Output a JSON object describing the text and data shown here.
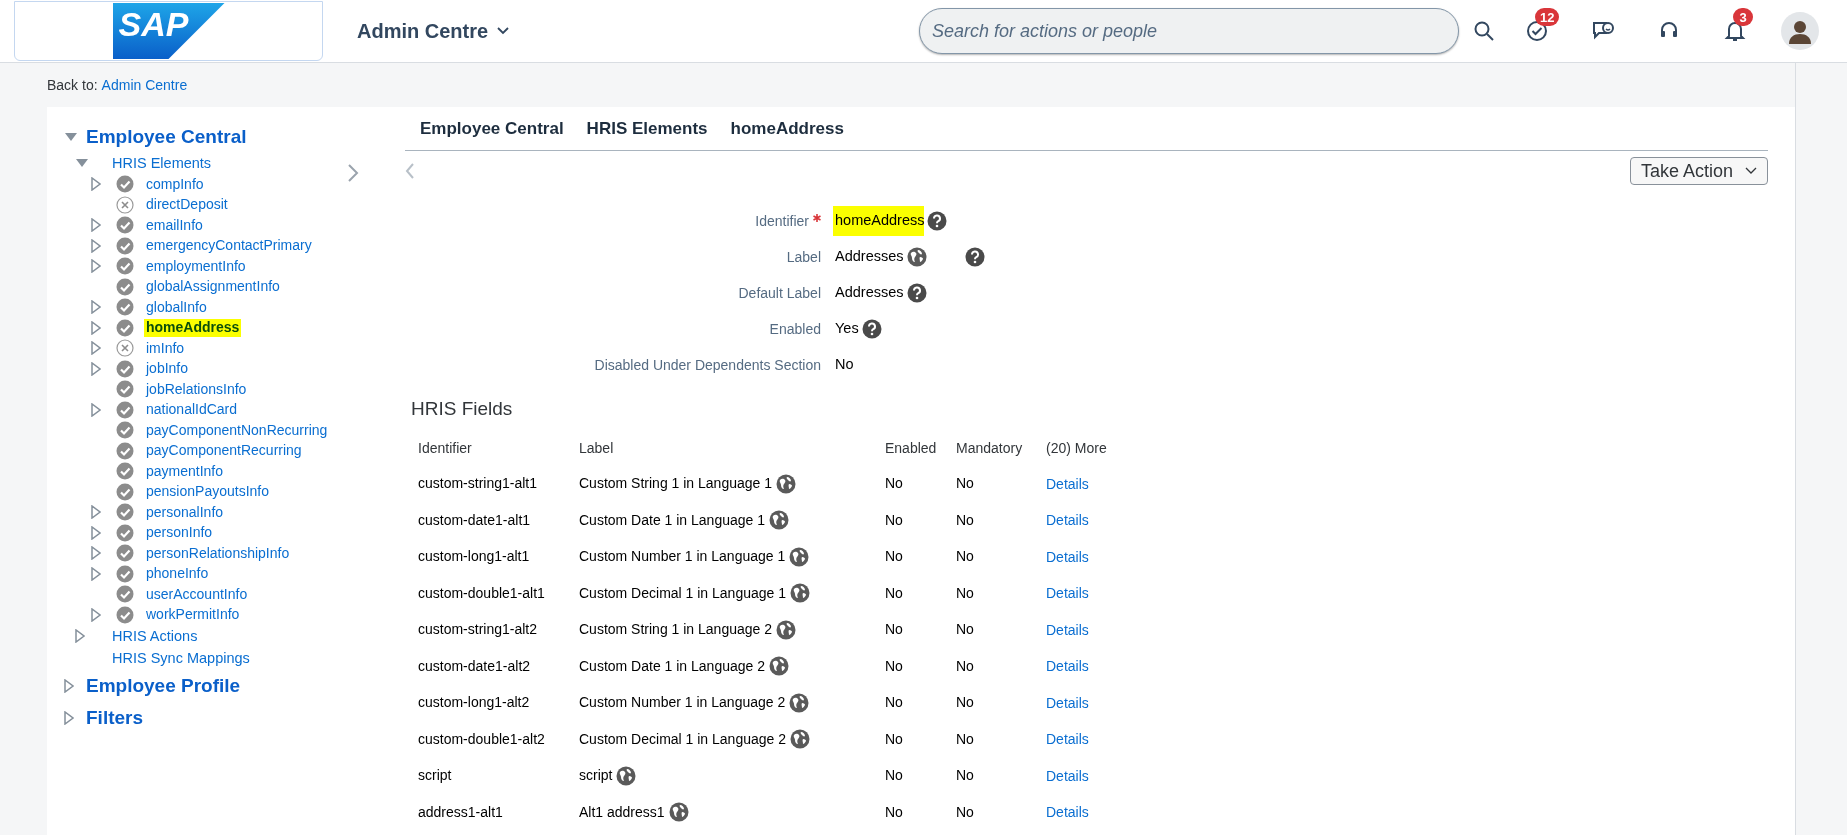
{
  "header": {
    "logo_text": "SAP",
    "app_title": "Admin Centre",
    "search": {
      "placeholder": "Search for actions or people"
    },
    "badges": [
      {
        "kind": "tasks",
        "count": "12"
      },
      {
        "kind": "feedback"
      },
      {
        "kind": "support"
      },
      {
        "kind": "notifications",
        "count": "3"
      }
    ]
  },
  "back_link": {
    "label": "Back to:",
    "link": "Admin Centre"
  },
  "tree": [
    {
      "label": "Employee Central",
      "expandable": true,
      "expanded": true,
      "selected": false,
      "children": [
        {
          "label": "HRIS Elements",
          "expandable": true,
          "expanded": true,
          "selected": false,
          "children": [
            {
              "label": "compInfo",
              "expandable": true,
              "expanded": false,
              "enabled": true,
              "selected": false
            },
            {
              "label": "directDeposit",
              "expandable": false,
              "enabled": false,
              "selected": false
            },
            {
              "label": "emailInfo",
              "expandable": true,
              "expanded": false,
              "enabled": true,
              "selected": false
            },
            {
              "label": "emergencyContactPrimary",
              "expandable": true,
              "expanded": false,
              "enabled": true,
              "selected": false
            },
            {
              "label": "employmentInfo",
              "expandable": true,
              "expanded": false,
              "enabled": true,
              "selected": false
            },
            {
              "label": "globalAssignmentInfo",
              "expandable": false,
              "enabled": true,
              "selected": false
            },
            {
              "label": "globalInfo",
              "expandable": true,
              "expanded": false,
              "enabled": true,
              "selected": false
            },
            {
              "label": "homeAddress",
              "expandable": true,
              "expanded": false,
              "enabled": true,
              "selected": true
            },
            {
              "label": "imInfo",
              "expandable": true,
              "expanded": false,
              "enabled": false,
              "selected": false
            },
            {
              "label": "jobInfo",
              "expandable": true,
              "expanded": false,
              "enabled": true,
              "selected": false
            },
            {
              "label": "jobRelationsInfo",
              "expandable": false,
              "enabled": true,
              "selected": false
            },
            {
              "label": "nationalIdCard",
              "expandable": true,
              "expanded": false,
              "enabled": true,
              "selected": false
            },
            {
              "label": "payComponentNonRecurring",
              "expandable": false,
              "enabled": true,
              "selected": false
            },
            {
              "label": "payComponentRecurring",
              "expandable": false,
              "enabled": true,
              "selected": false
            },
            {
              "label": "paymentInfo",
              "expandable": false,
              "enabled": true,
              "selected": false
            },
            {
              "label": "pensionPayoutsInfo",
              "expandable": false,
              "enabled": true,
              "selected": false
            },
            {
              "label": "personalInfo",
              "expandable": true,
              "expanded": false,
              "enabled": true,
              "selected": false
            },
            {
              "label": "personInfo",
              "expandable": true,
              "expanded": false,
              "enabled": true,
              "selected": false
            },
            {
              "label": "personRelationshipInfo",
              "expandable": true,
              "expanded": false,
              "enabled": true,
              "selected": false
            },
            {
              "label": "phoneInfo",
              "expandable": true,
              "expanded": false,
              "enabled": true,
              "selected": false
            },
            {
              "label": "userAccountInfo",
              "expandable": false,
              "enabled": true,
              "selected": false
            },
            {
              "label": "workPermitInfo",
              "expandable": true,
              "expanded": false,
              "enabled": true,
              "selected": false
            }
          ]
        },
        {
          "label": "HRIS Actions",
          "expandable": true,
          "expanded": false,
          "selected": false
        },
        {
          "label": "HRIS Sync Mappings",
          "expandable": false,
          "selected": false
        }
      ]
    },
    {
      "label": "Employee Profile",
      "expandable": true,
      "expanded": false,
      "selected": false
    },
    {
      "label": "Filters",
      "expandable": true,
      "expanded": false,
      "selected": false
    }
  ],
  "breadcrumb": [
    "Employee Central",
    "HRIS Elements",
    "homeAddress"
  ],
  "take_action": "Take Action",
  "fields": [
    {
      "label": "Identifier",
      "value": "homeAddress",
      "required": true,
      "highlighted": true,
      "translatable": false,
      "help": true
    },
    {
      "label": "Label",
      "value": "Addresses",
      "required": false,
      "highlighted": false,
      "translatable": true,
      "help": true
    },
    {
      "label": "Default Label",
      "value": "Addresses",
      "required": false,
      "highlighted": false,
      "translatable": false,
      "help": true
    },
    {
      "label": "Enabled",
      "value": "Yes",
      "required": false,
      "highlighted": false,
      "translatable": false,
      "help": true
    },
    {
      "label": "Disabled Under Dependents Section",
      "value": "No",
      "required": false,
      "highlighted": false,
      "translatable": false,
      "help": false
    }
  ],
  "hris_fields": {
    "title": "HRIS Fields",
    "columns": [
      "Identifier",
      "Label",
      "Enabled",
      "Mandatory",
      "(20) More"
    ],
    "rows": [
      {
        "identifier": "custom-string1-alt1",
        "label": "Custom String 1 in Language 1",
        "translatable": true,
        "enabled": "No",
        "mandatory": "No",
        "link": "Details"
      },
      {
        "identifier": "custom-date1-alt1",
        "label": "Custom Date 1 in Language 1",
        "translatable": true,
        "enabled": "No",
        "mandatory": "No",
        "link": "Details"
      },
      {
        "identifier": "custom-long1-alt1",
        "label": "Custom Number 1 in Language 1",
        "translatable": true,
        "enabled": "No",
        "mandatory": "No",
        "link": "Details"
      },
      {
        "identifier": "custom-double1-alt1",
        "label": "Custom Decimal 1 in Language 1",
        "translatable": true,
        "enabled": "No",
        "mandatory": "No",
        "link": "Details"
      },
      {
        "identifier": "custom-string1-alt2",
        "label": "Custom String 1 in Language 2",
        "translatable": true,
        "enabled": "No",
        "mandatory": "No",
        "link": "Details"
      },
      {
        "identifier": "custom-date1-alt2",
        "label": "Custom Date 1 in Language 2",
        "translatable": true,
        "enabled": "No",
        "mandatory": "No",
        "link": "Details"
      },
      {
        "identifier": "custom-long1-alt2",
        "label": "Custom Number 1 in Language 2",
        "translatable": true,
        "enabled": "No",
        "mandatory": "No",
        "link": "Details"
      },
      {
        "identifier": "custom-double1-alt2",
        "label": "Custom Decimal 1 in Language 2",
        "translatable": true,
        "enabled": "No",
        "mandatory": "No",
        "link": "Details"
      },
      {
        "identifier": "script",
        "label": "script",
        "translatable": true,
        "enabled": "No",
        "mandatory": "No",
        "link": "Details"
      },
      {
        "identifier": "address1-alt1",
        "label": "Alt1 address1",
        "translatable": true,
        "enabled": "No",
        "mandatory": "No",
        "link": "Details"
      }
    ]
  }
}
